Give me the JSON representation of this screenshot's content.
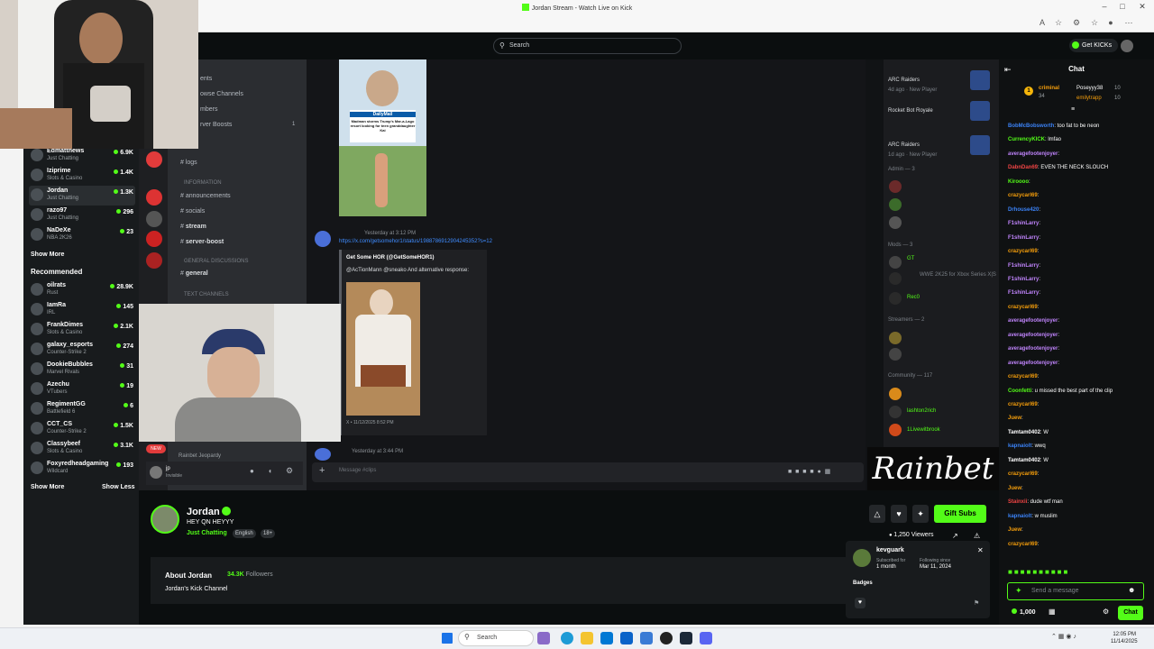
{
  "browser": {
    "tab_title": "Jordan Stream - Watch Live on Kick"
  },
  "topbar": {
    "search_placeholder": "Search",
    "get_kicks_label": "Get KICKs"
  },
  "sidebar": {
    "following": [
      {
        "name": "Edmatthews",
        "category": "Just Chatting",
        "viewers": "6.9K"
      },
      {
        "name": "Iziprime",
        "category": "Slots & Casino",
        "viewers": "1.4K"
      },
      {
        "name": "Jordan",
        "category": "Just Chatting",
        "viewers": "1.3K"
      },
      {
        "name": "razo97",
        "category": "Just Chatting",
        "viewers": "296"
      },
      {
        "name": "NaDeXe",
        "category": "NBA 2K26",
        "viewers": "23"
      }
    ],
    "show_more_label": "Show More",
    "recommended_heading": "Recommended",
    "recommended": [
      {
        "name": "oilrats",
        "category": "Rust",
        "viewers": "28.9K"
      },
      {
        "name": "IamRa",
        "category": "IRL",
        "viewers": "145"
      },
      {
        "name": "FrankDimes",
        "category": "Slots & Casino",
        "viewers": "2.1K"
      },
      {
        "name": "galaxy_esports",
        "category": "Counter-Strike 2",
        "viewers": "274"
      },
      {
        "name": "DookieBubbles",
        "category": "Marvel Rivals",
        "viewers": "31"
      },
      {
        "name": "Azechu",
        "category": "VTubers",
        "viewers": "19"
      },
      {
        "name": "RegimentGG",
        "category": "Battlefield 6",
        "viewers": "6"
      },
      {
        "name": "CCT_CS",
        "category": "Counter-Strike 2",
        "viewers": "1.5K"
      },
      {
        "name": "Classybeef",
        "category": "Slots & Casino",
        "viewers": "3.1K"
      },
      {
        "name": "Foxyredheadgaming",
        "category": "Wildcard",
        "viewers": "193"
      }
    ],
    "show_more_label_2": "Show More",
    "show_less_label": "Show Less"
  },
  "discord": {
    "channels_top": [
      "ents",
      "owse Channels",
      "mbers",
      "rver Boosts"
    ],
    "boost_count": "1",
    "channels": [
      {
        "name": "logs"
      },
      {
        "group": "INFORMATION"
      },
      {
        "name": "announcements"
      },
      {
        "name": "socials"
      },
      {
        "name": "stream",
        "bold": true
      },
      {
        "name": "server-boost",
        "bold": true
      },
      {
        "group": "GENERAL DISCUSSIONS"
      },
      {
        "name": "general",
        "bold": true
      },
      {
        "group": "TEXT CHANNELS"
      }
    ],
    "message_time_1": "Yesterday at 3:12 PM",
    "link": "https://x.com/getsomehor1/status/1988786912904245352?s=12",
    "embed_author": "Get Some HOR (@GetSomeHOR1)",
    "embed_text": "@AcTionMann @sneako And alternative response:",
    "embed_footer": "X • 11/12/2025 8:52 PM",
    "message_time_2": "Yesterday at 3:44 PM",
    "voice_user": "Rainbet Jeopardy",
    "self_name": "jp",
    "self_status": "Invisible",
    "message_placeholder": "Message #clips",
    "image_caption_brand": "DailyMail",
    "image_caption_text": "Madman storms Trump's Mar-a-Lago resort looking for teen granddaughter Kai",
    "members": [
      {
        "name": "ARC Raiders",
        "sub": "4d ago · New Player"
      },
      {
        "name": "Rocket Bot Royale",
        "sub": ""
      },
      {
        "name": "ARC Raiders",
        "sub": "1d ago · New Player"
      }
    ],
    "admin_header": "Admin — 3",
    "mods_header": "Mods — 3",
    "mods": [
      "GT",
      "Rec0"
    ],
    "mod_sub": "WWE 2K25 for Xbox Series X|S",
    "streamers_header": "Streamers — 2",
    "community_header": "Community — 117",
    "community": [
      "lashton2rich",
      "1Livewitbrook"
    ],
    "sponsor": "Rainbet"
  },
  "stream": {
    "streamer": "Jordan",
    "title": "HEY QN HEYYY",
    "category": "Just Chatting",
    "tags": [
      "English",
      "18+"
    ],
    "gift_subs_label": "Gift Subs",
    "viewers": "1,250 Viewers",
    "about_title": "About Jordan",
    "followers_count": "34.3K",
    "followers_label": "Followers",
    "about_desc": "Jordan's Kick Channel"
  },
  "user_card": {
    "username": "kevguark",
    "subscribed_label": "Subscribed for",
    "subscribed_value": "1 month",
    "following_label": "Following since",
    "following_value": "Mar 11, 2024",
    "badges_label": "Badges"
  },
  "chat": {
    "title": "Chat",
    "pinned": [
      {
        "user": "criminal",
        "value": "34"
      },
      {
        "user": "Poseyyy38",
        "value": "10"
      },
      {
        "user": "emilytrapp",
        "value": "10"
      }
    ],
    "messages": [
      {
        "user": "BobMcBobsworth",
        "color": "#3b82f6",
        "text": ": too fat to be neon"
      },
      {
        "user": "CurrencyKICK",
        "color": "#53fc18",
        "text": ": lmfao"
      },
      {
        "user": "averagefootenjoyer",
        "color": "#c084fc",
        "text": ":"
      },
      {
        "user": "DabnDan69",
        "color": "#ef4444",
        "text": ": EVEN THE NECK SLOUCH"
      },
      {
        "user": "Kiroooo",
        "color": "#53fc18",
        "text": ":"
      },
      {
        "user": "crazycarl69",
        "color": "#f59e0b",
        "text": ":"
      },
      {
        "user": "Drhouse420",
        "color": "#3b82f6",
        "text": ":"
      },
      {
        "user": "F1shinLarry",
        "color": "#c084fc",
        "text": ":"
      },
      {
        "user": "F1shinLarry",
        "color": "#c084fc",
        "text": ":"
      },
      {
        "user": "crazycarl69",
        "color": "#f59e0b",
        "text": ":"
      },
      {
        "user": "F1shinLarry",
        "color": "#c084fc",
        "text": ":"
      },
      {
        "user": "F1shinLarry",
        "color": "#c084fc",
        "text": ":"
      },
      {
        "user": "F1shinLarry",
        "color": "#c084fc",
        "text": ":"
      },
      {
        "user": "crazycarl69",
        "color": "#f59e0b",
        "text": ":"
      },
      {
        "user": "averagefootenjoyer",
        "color": "#c084fc",
        "text": ":"
      },
      {
        "user": "averagefootenjoyer",
        "color": "#c084fc",
        "text": ":"
      },
      {
        "user": "averagefootenjoyer",
        "color": "#c084fc",
        "text": ":"
      },
      {
        "user": "averagefootenjoyer",
        "color": "#c084fc",
        "text": ":"
      },
      {
        "user": "crazycarl69",
        "color": "#f59e0b",
        "text": ":"
      },
      {
        "user": "Coonfetti",
        "color": "#53fc18",
        "text": ": u missed the best part of the clip"
      },
      {
        "user": "crazycarl69",
        "color": "#f59e0b",
        "text": ":"
      },
      {
        "user": "Juew",
        "color": "#f59e0b",
        "text": ":"
      },
      {
        "user": "Tamtam0402",
        "color": "#fff",
        "text": ": W"
      },
      {
        "user": "kapnaiolt",
        "color": "#3b82f6",
        "text": ": wwq"
      },
      {
        "user": "Tamtam0402",
        "color": "#fff",
        "text": ": W"
      },
      {
        "user": "crazycarl69",
        "color": "#f59e0b",
        "text": ":"
      },
      {
        "user": "Juew",
        "color": "#f59e0b",
        "text": ":"
      },
      {
        "user": "Stainxii",
        "color": "#ef4444",
        "text": ": dude wtf man"
      },
      {
        "user": "kapnaiolt",
        "color": "#3b82f6",
        "text": ": w muslim"
      },
      {
        "user": "Juew",
        "color": "#f59e0b",
        "text": ":"
      },
      {
        "user": "crazycarl69",
        "color": "#f59e0b",
        "text": ":"
      }
    ],
    "input_placeholder": "Send a message",
    "kicks_balance": "1,000",
    "send_label": "Chat"
  },
  "taskbar": {
    "search_placeholder": "Search",
    "time": "12:05 PM",
    "date": "11/14/2025"
  },
  "colors": {
    "kick_green": "#53fc18",
    "page_bg": "#0b0e0f",
    "sidebar_bg": "#181b1d"
  }
}
